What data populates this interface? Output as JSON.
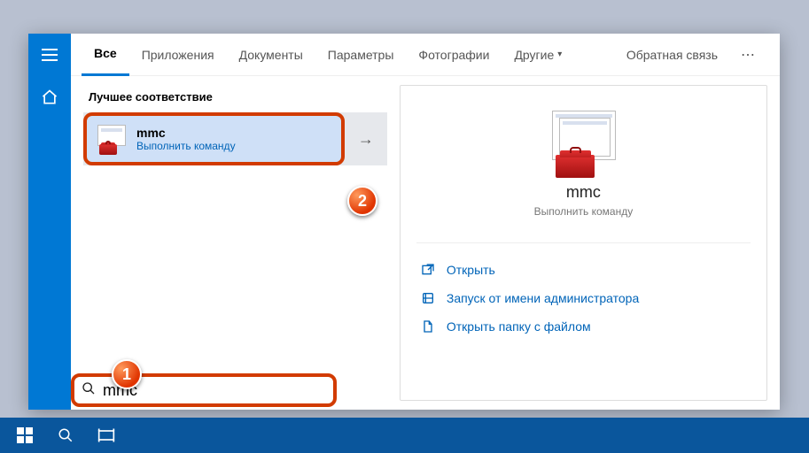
{
  "tabs": {
    "all": "Все",
    "apps": "Приложения",
    "docs": "Документы",
    "params": "Параметры",
    "photos": "Фотографии",
    "other": "Другие"
  },
  "header": {
    "feedback": "Обратная связь"
  },
  "left": {
    "section": "Лучшее соответствие",
    "result_title": "mmc",
    "result_sub": "Выполнить команду"
  },
  "detail": {
    "title": "mmc",
    "sub": "Выполнить команду",
    "actions": {
      "open": "Открыть",
      "admin": "Запуск от имени администратора",
      "folder": "Открыть папку с файлом"
    }
  },
  "search": {
    "value": "mmc"
  },
  "callouts": {
    "one": "1",
    "two": "2"
  }
}
